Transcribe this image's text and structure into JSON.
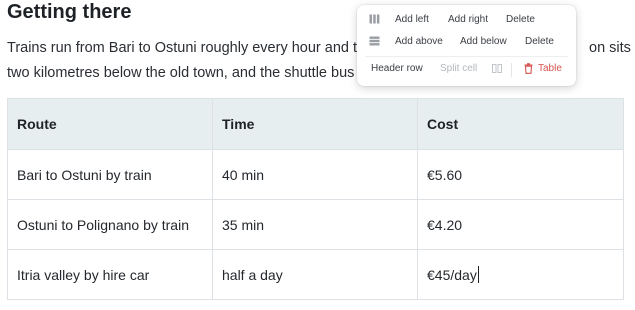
{
  "article": {
    "heading": "Getting there",
    "paragraph_line1": "Trains run from Bari to Ostuni roughly every hour and t",
    "paragraph_line1_tail": "on sits",
    "paragraph_line2": "two kilometres below the old town, and the shuttle bus"
  },
  "table": {
    "headers": [
      "Route",
      "Time",
      "Cost"
    ],
    "rows": [
      [
        "Bari to Ostuni by train",
        "40 min",
        "€5.60"
      ],
      [
        "Ostuni to Polignano by train",
        "35 min",
        "€4.20"
      ],
      [
        "Itria valley by hire car",
        "half a day",
        "€45/day"
      ]
    ]
  },
  "menu": {
    "add_left": "Add left",
    "add_right": "Add right",
    "delete_column": "Delete",
    "add_above": "Add above",
    "add_below": "Add below",
    "delete_row": "Delete",
    "header_row": "Header row",
    "split_cell": "Split cell",
    "delete_table": "Table"
  },
  "colors": {
    "header_bg": "#e6eef0",
    "danger": "#d9534f"
  }
}
